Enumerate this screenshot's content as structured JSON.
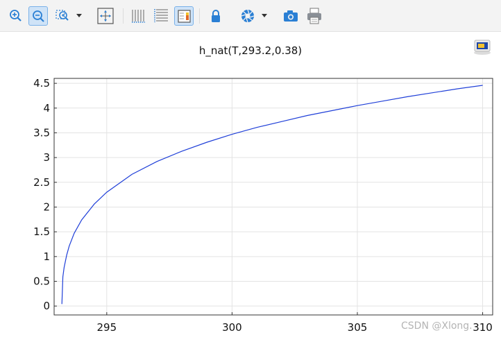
{
  "toolbar": {
    "buttons": [
      {
        "name": "zoom-in-icon"
      },
      {
        "name": "zoom-out-icon",
        "active": true
      },
      {
        "name": "zoom-box-icon"
      },
      {
        "name": "dropdown-arrow-icon"
      },
      {
        "name": "zoom-extents-icon"
      },
      {
        "name": "x-grid-icon"
      },
      {
        "name": "y-grid-icon"
      },
      {
        "name": "legend-icon",
        "active": true
      },
      {
        "name": "lock-icon"
      },
      {
        "name": "scene-light-icon"
      },
      {
        "name": "dropdown-arrow-icon"
      },
      {
        "name": "camera-icon"
      },
      {
        "name": "print-icon"
      }
    ]
  },
  "plot": {
    "title": "h_nat(T,293.2,0.38)"
  },
  "watermark": "CSDN @Xlong.",
  "colors": {
    "line": "#1f3fd8",
    "grid": "#e3e3e3",
    "axis": "#333333",
    "active_button": "#cfe3f7"
  },
  "chart_data": {
    "type": "line",
    "title": "h_nat(T,293.2,0.38)",
    "xlabel": "",
    "ylabel": "",
    "xlim": [
      292.9,
      310.4
    ],
    "ylim": [
      -0.18,
      4.6
    ],
    "xticks": [
      295,
      300,
      305,
      310
    ],
    "yticks": [
      0,
      0.5,
      1,
      1.5,
      2,
      2.5,
      3,
      3.5,
      4,
      4.5
    ],
    "xtick_labels": [
      "295",
      "300",
      "305",
      "310"
    ],
    "ytick_labels": [
      "0",
      "0.5",
      "1",
      "1.5",
      "2",
      "2.5",
      "3",
      "3.5",
      "4",
      "4.5"
    ],
    "grid": true,
    "series": [
      {
        "x": [
          293.21,
          293.25,
          293.3,
          293.4,
          293.5,
          293.7,
          294.0,
          294.5,
          295.0,
          296.0,
          297.0,
          298.0,
          299.0,
          300.0,
          301.0,
          302.0,
          303.0,
          304.0,
          305.0,
          306.0,
          307.0,
          308.0,
          309.0,
          310.0
        ],
        "y": [
          0.04,
          0.59,
          0.78,
          1.03,
          1.21,
          1.47,
          1.74,
          2.06,
          2.3,
          2.66,
          2.92,
          3.13,
          3.31,
          3.47,
          3.61,
          3.73,
          3.85,
          3.95,
          4.05,
          4.14,
          4.23,
          4.31,
          4.39,
          4.46
        ]
      }
    ]
  }
}
